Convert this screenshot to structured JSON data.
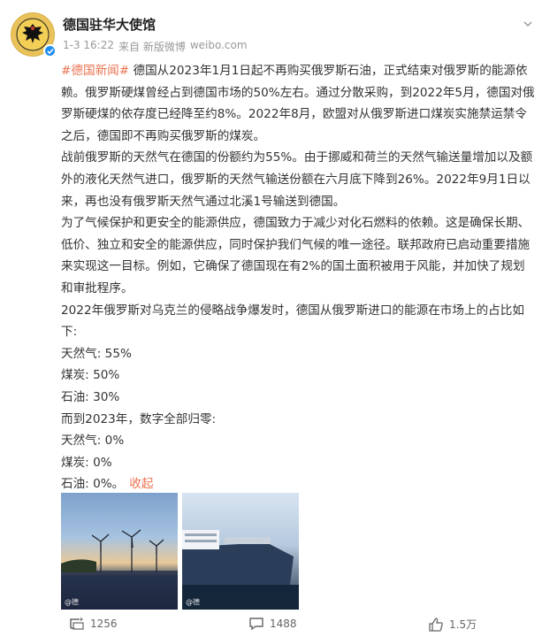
{
  "account": {
    "name": "德国驻华大使馆",
    "meta_time": "1-3 16:22",
    "meta_source": "来自 新版微博",
    "meta_site": "weibo.com"
  },
  "post": {
    "hashtag": "#德国新闻#",
    "paragraphs": [
      " 德国从2023年1月1日起不再购买俄罗斯石油，正式结束对俄罗斯的能源依赖。俄罗斯硬煤曾经占到德国市场的50%左右。通过分散采购，到2022年5月，德国对俄罗斯硬煤的依存度已经降至约8%。2022年8月，欧盟对从俄罗斯进口煤炭实施禁运禁令之后，德国即不再购买俄罗斯的煤炭。",
      "战前俄罗斯的天然气在德国的份额约为55%。由于挪威和荷兰的天然气输送量增加以及额外的液化天然气进口，俄罗斯的天然气输送份额在六月底下降到26%。2022年9月1日以来，再也没有俄罗斯天然气通过北溪1号输送到德国。",
      "为了气候保护和更安全的能源供应，德国致力于减少对化石燃料的依赖。这是确保长期、低价、独立和安全的能源供应，同时保护我们气候的唯一途径。联邦政府已启动重要措施来实现这一目标。例如，它确保了德国现在有2%的国土面积被用于风能，并加快了规划和审批程序。",
      "2022年俄罗斯对乌克兰的侵略战争爆发时，德国从俄罗斯进口的能源在市场上的占比如下:",
      "天然气: 55%",
      "煤炭: 50%",
      "石油: 30%",
      "而到2023年，数字全部归零:",
      "天然气: 0%",
      "煤炭: 0%",
      "石油: 0%。"
    ],
    "collapse_label": "收起",
    "images": [
      {
        "watermark": "@德"
      },
      {
        "watermark": "@德"
      }
    ]
  },
  "actions": {
    "repost_count": "1256",
    "comment_count": "1488",
    "like_count": "1.5万"
  },
  "colors": {
    "hashtag": "#eb7350",
    "verified": "#1f8ef0"
  }
}
